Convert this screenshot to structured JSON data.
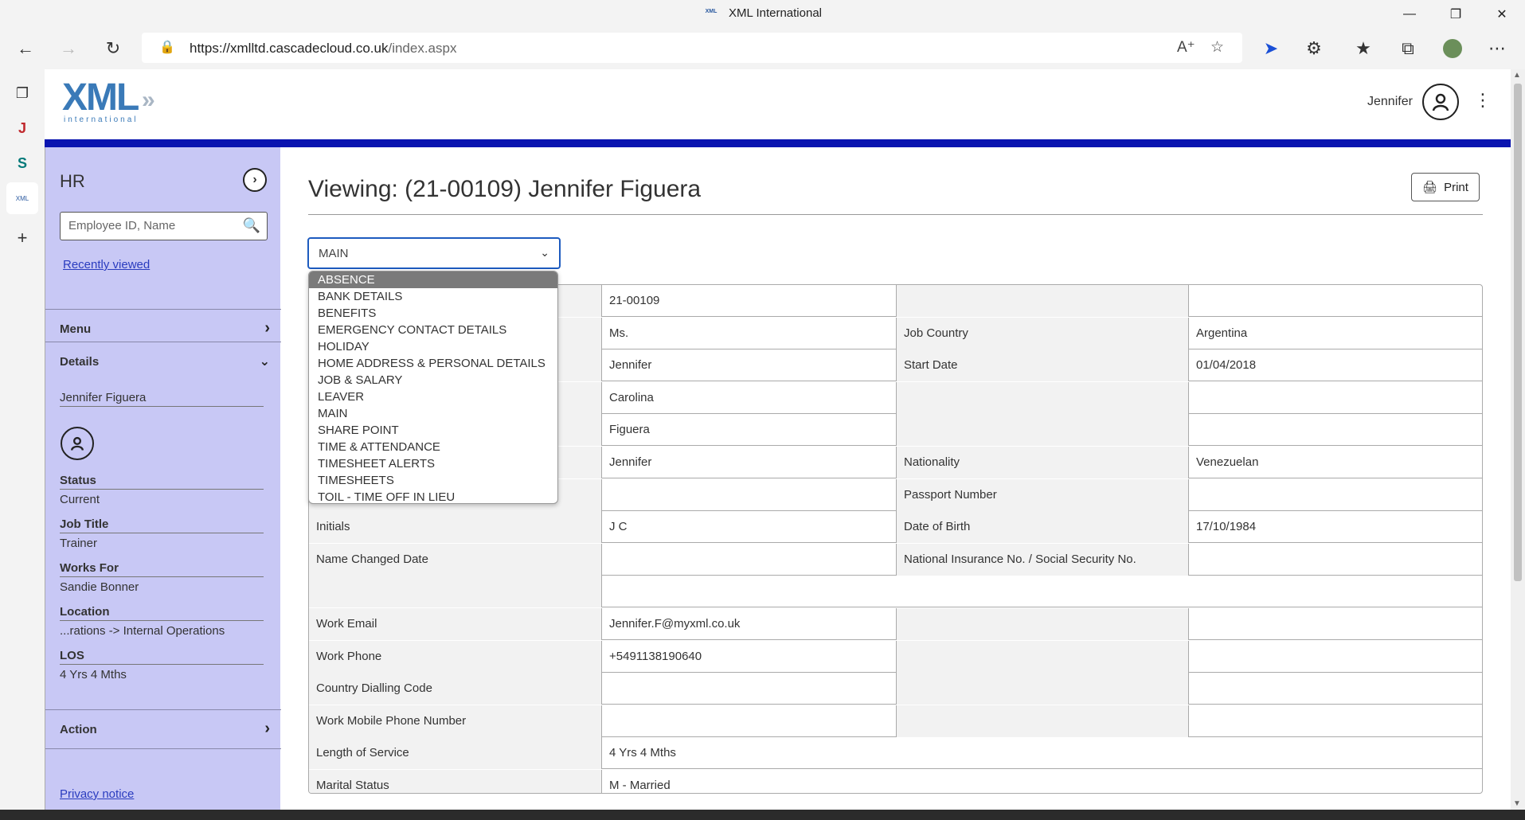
{
  "browser": {
    "window_title": "XML International",
    "favicon_text": "XML",
    "url_host": "https://xmlltd.cascadecloud.co.uk",
    "url_path": "/index.aspx"
  },
  "header": {
    "logo_text": "XML",
    "logo_sub": "international",
    "user_name": "Jennifer"
  },
  "sidebar": {
    "title": "HR",
    "search_placeholder": "Employee ID, Name",
    "recently_viewed": "Recently viewed",
    "menu_label": "Menu",
    "details_label": "Details",
    "person_name": "Jennifer Figuera",
    "fields": [
      {
        "label": "Status",
        "value": "Current"
      },
      {
        "label": "Job Title",
        "value": "Trainer"
      },
      {
        "label": "Works For",
        "value": "Sandie Bonner"
      },
      {
        "label": "Location",
        "value": "...rations -> Internal Operations"
      },
      {
        "label": "LOS",
        "value": "4 Yrs 4 Mths"
      }
    ],
    "action_label": "Action",
    "privacy": "Privacy notice"
  },
  "main": {
    "title": "Viewing:  (21-00109) Jennifer Figuera",
    "print_label": "Print",
    "selected_view": "MAIN",
    "dropdown_options": [
      "ABSENCE",
      "BANK DETAILS",
      "BENEFITS",
      "EMERGENCY CONTACT DETAILS",
      "HOLIDAY",
      "HOME ADDRESS & PERSONAL DETAILS",
      "JOB & SALARY",
      "LEAVER",
      "MAIN",
      "SHARE POINT",
      "TIME & ATTENDANCE",
      "TIMESHEET ALERTS",
      "TIMESHEETS",
      "TOIL - TIME OFF IN LIEU"
    ],
    "highlighted_option": "ABSENCE"
  },
  "table": {
    "rows": [
      {
        "l1": "",
        "v1": "21-00109",
        "l2": "",
        "v2": ""
      },
      {
        "l1": "",
        "v1": "Ms.",
        "l2": "Job Country",
        "v2": "Argentina"
      },
      {
        "l1": "",
        "v1": "Jennifer",
        "l2": "Start Date",
        "v2": "01/04/2018"
      },
      {
        "l1": "",
        "v1": "Carolina",
        "l2": "",
        "v2": ""
      },
      {
        "l1": "",
        "v1": "Figuera",
        "l2": "",
        "v2": ""
      },
      {
        "l1": "",
        "v1": "Jennifer",
        "l2": "Nationality",
        "v2": "Venezuelan"
      },
      {
        "l1": "",
        "v1": "",
        "l2": "Passport Number",
        "v2": ""
      },
      {
        "l1": "Initials",
        "v1": "J C",
        "l2": "Date of Birth",
        "v2": "17/10/1984"
      },
      {
        "l1": "Name Changed Date",
        "v1": "",
        "l2": "National Insurance No. / Social Security No.",
        "v2": ""
      },
      {
        "l1": "",
        "v1": "",
        "l2": null,
        "v2": null
      },
      {
        "l1": "Work Email",
        "v1": "Jennifer.F@myxml.co.uk",
        "l2": "",
        "v2": ""
      },
      {
        "l1": "Work Phone",
        "v1": "+5491138190640",
        "l2": "",
        "v2": ""
      },
      {
        "l1": "Country Dialling Code",
        "v1": "",
        "l2": "",
        "v2": ""
      },
      {
        "l1": "Work Mobile Phone Number",
        "v1": "",
        "l2": "",
        "v2": ""
      },
      {
        "l1": "Length of Service",
        "v1": "4 Yrs 4 Mths",
        "l2": null,
        "v2": null
      },
      {
        "l1": "Marital Status",
        "v1": "M - Married",
        "l2": null,
        "v2": null
      }
    ]
  }
}
